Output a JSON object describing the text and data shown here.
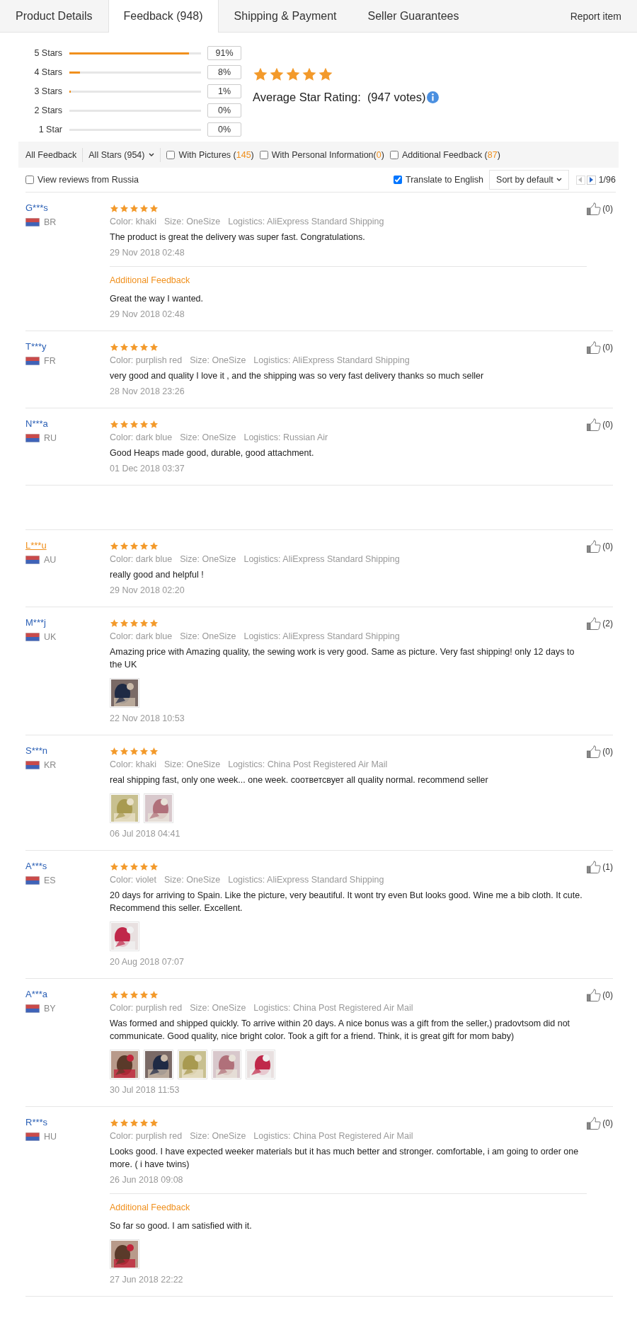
{
  "tabs": [
    {
      "label": "Product Details",
      "selected": false
    },
    {
      "label": "Feedback (948)",
      "selected": true
    },
    {
      "label": "Shipping & Payment",
      "selected": false
    },
    {
      "label": "Seller Guarantees",
      "selected": false
    }
  ],
  "report_link": "Report item",
  "rating_breakdown": [
    {
      "label": "5 Stars",
      "level": 0.91,
      "percent": "91%"
    },
    {
      "label": "4 Stars",
      "level": 0.08,
      "percent": "8%"
    },
    {
      "label": "3 Stars",
      "level": 0.01,
      "percent": "1%"
    },
    {
      "label": "2 Stars",
      "level": 0,
      "percent": "0%"
    },
    {
      "label": "1 Star",
      "level": 0,
      "percent": "0%"
    }
  ],
  "summary": {
    "stars": 5,
    "label": "Average Star Rating:",
    "votes": "(947 votes)"
  },
  "filters": {
    "all_feedback": "All Feedback",
    "stars_dropdown": "All Stars (954)",
    "checkboxes": [
      {
        "label": "With Pictures (",
        "count": "145",
        "end": ")",
        "checked": false
      },
      {
        "label": "With Personal Information(",
        "count": "0",
        "end": ")",
        "checked": false
      },
      {
        "label": "Additional Feedback (",
        "count": "87",
        "end": ")",
        "checked": false
      }
    ]
  },
  "options": {
    "region_filter": {
      "label": "View reviews from Russia",
      "checked": false
    },
    "translate": {
      "label": "Translate to English",
      "checked": true
    },
    "sort": "Sort by default",
    "pager": {
      "prev_disabled": true,
      "next_disabled": false,
      "page": "1/96"
    }
  },
  "reviews": [
    {
      "name": "G***s",
      "highlighted": false,
      "country": "BR",
      "stars": 5,
      "variant": "Color: khaki",
      "size": "Size: OneSize",
      "logistics": "Logistics: AliExpress Standard Shipping",
      "text": "The product is great the delivery was super fast. Congratulations.",
      "date": "29 Nov 2018 02:48",
      "likes": "(0)",
      "additional": {
        "label": "Additional Feedback",
        "text": "Great the way I wanted.",
        "date": "29 Nov 2018 02:48"
      }
    },
    {
      "name": "T***y",
      "highlighted": false,
      "country": "FR",
      "stars": 5,
      "variant": "Color: purplish red",
      "size": "Size: OneSize",
      "logistics": "Logistics: AliExpress Standard Shipping",
      "text": "very good and quality I love it , and the shipping was so very fast delivery thanks so much seller",
      "date": "28 Nov 2018 23:26",
      "likes": "(0)"
    },
    {
      "name": "N***a",
      "highlighted": false,
      "country": "RU",
      "stars": 5,
      "variant": "Color: dark blue",
      "size": "Size: OneSize",
      "logistics": "Logistics: Russian Air",
      "text": "Good Heaps made good, durable, good attachment.",
      "date": "01 Dec 2018 03:37",
      "likes": "(0)"
    },
    {
      "name": "L***u",
      "highlighted": true,
      "section_break": true,
      "country": "AU",
      "stars": 5,
      "variant": "Color: dark blue",
      "size": "Size: OneSize",
      "logistics": "Logistics: AliExpress Standard Shipping",
      "text": "really good and helpful !",
      "date": "29 Nov 2018 02:20",
      "likes": "(0)"
    },
    {
      "name": "M***j",
      "highlighted": false,
      "country": "UK",
      "stars": 5,
      "variant": "Color: dark blue",
      "size": "Size: OneSize",
      "logistics": "Logistics: AliExpress Standard Shipping",
      "text": "Amazing price with Amazing quality, the sewing work is very good. Same as picture. Very fast shipping! only 12 days to the UK",
      "photos": [
        {
          "kind": "picture"
        }
      ],
      "date": "22 Nov 2018 10:53",
      "likes": "(2)"
    },
    {
      "name": "S***n",
      "highlighted": false,
      "country": "KR",
      "stars": 5,
      "variant": "Color: khaki",
      "size": "Size: OneSize",
      "logistics": "Logistics: China Post Registered Air Mail",
      "text": "real shipping fast, only one week... one week. соответсвует all quality normal. recommend seller",
      "photos": [
        {
          "kind": "picture"
        },
        {
          "kind": "picture"
        }
      ],
      "date": "06 Jul 2018 04:41",
      "likes": "(0)"
    },
    {
      "name": "A***s",
      "highlighted": false,
      "country": "ES",
      "stars": 5,
      "variant": "Color: violet",
      "size": "Size: OneSize",
      "logistics": "Logistics: AliExpress Standard Shipping",
      "text": "20 days for arriving to Spain. Like the picture, very beautiful. It wont try even But looks good. Wine me a bib cloth. It cute. Recommend this seller. Excellent.",
      "photos": [
        {
          "kind": "picture"
        }
      ],
      "date": "20 Aug 2018 07:07",
      "likes": "(1)"
    },
    {
      "name": "A***a",
      "highlighted": false,
      "country": "BY",
      "stars": 5,
      "variant": "Color: purplish red",
      "size": "Size: OneSize",
      "logistics": "Logistics: China Post Registered Air Mail",
      "text": "Was formed and shipped quickly. To arrive within 20 days. A nice bonus was a gift from the seller,) pradovtsom did not communicate. Good quality, nice bright color. Took a gift for a friend. Think, it is great gift for mom baby)",
      "photos": [
        {
          "kind": "picture"
        },
        {
          "kind": "picture"
        },
        {
          "kind": "picture"
        },
        {
          "kind": "picture"
        },
        {
          "kind": "picture"
        }
      ],
      "date": "30 Jul 2018 11:53",
      "likes": "(0)"
    },
    {
      "name": "R***s",
      "highlighted": false,
      "country": "HU",
      "stars": 5,
      "variant": "Color: purplish red",
      "size": "Size: OneSize",
      "logistics": "Logistics: China Post Registered Air Mail",
      "text": "Looks good. I have expected weeker materials but it has much better and stronger. comfortable, i am going to order one more. ( i have twins)",
      "date": "26 Jun 2018 09:08",
      "likes": "(0)",
      "additional": {
        "label": "Additional Feedback",
        "text": "So far so good. I am satisfied with it.",
        "photos": [
          {
            "kind": "picture"
          }
        ],
        "date": "27 Jun 2018 22:22"
      }
    }
  ]
}
